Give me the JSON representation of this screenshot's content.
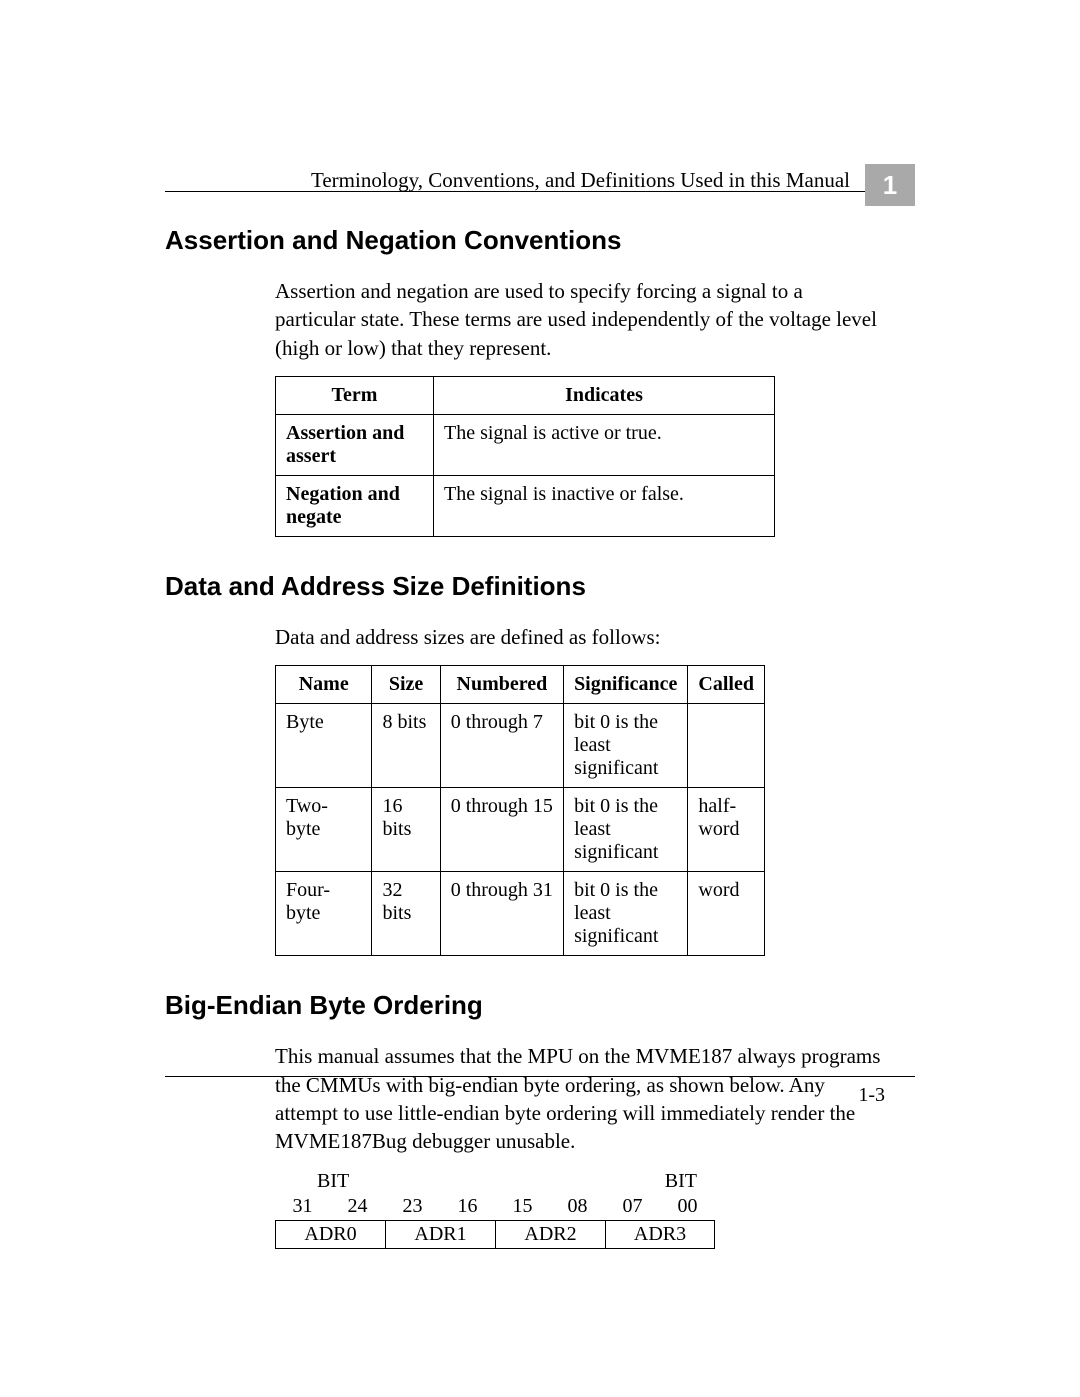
{
  "header": {
    "running_title": "Terminology, Conventions, and Definitions Used in this Manual",
    "chapter_number": "1"
  },
  "sections": {
    "s1": {
      "heading": "Assertion and Negation Conventions",
      "para": "Assertion and negation are used to specify forcing a signal to a particular state. These terms are used independently of the voltage level (high or low) that they represent.",
      "table": {
        "headers": {
          "term": "Term",
          "indicates": "Indicates"
        },
        "rows": [
          {
            "term": "Assertion and assert",
            "indicates": "The signal is active or true."
          },
          {
            "term": "Negation and negate",
            "indicates": "The signal is inactive or false."
          }
        ]
      }
    },
    "s2": {
      "heading": "Data and Address Size Definitions",
      "para": "Data and address sizes are defined as follows:",
      "table": {
        "headers": {
          "name": "Name",
          "size": "Size",
          "numbered": "Numbered",
          "significance": "Significance",
          "called": "Called"
        },
        "rows": [
          {
            "name": "Byte",
            "size": "8 bits",
            "numbered": "0 through 7",
            "significance": "bit 0 is the least significant",
            "called": ""
          },
          {
            "name": "Two-byte",
            "size": "16 bits",
            "numbered": "0 through 15",
            "significance": "bit 0 is the least significant",
            "called": "half-word"
          },
          {
            "name": "Four-byte",
            "size": "32 bits",
            "numbered": "0 through 31",
            "significance": "bit 0 is the least significant",
            "called": "word"
          }
        ]
      }
    },
    "s3": {
      "heading": "Big-Endian Byte Ordering",
      "para": "This manual assumes that the MPU on the MVME187 always programs the CMMUs with big-endian byte ordering, as shown below. Any attempt to use little-endian byte ordering will immediately render the MVME187Bug debugger unusable.",
      "diagram": {
        "bit_label_left": "BIT",
        "bit_label_right": "BIT",
        "nums": [
          "31",
          "24",
          "23",
          "16",
          "15",
          "08",
          "07",
          "00"
        ],
        "cells": [
          "ADR0",
          "ADR1",
          "ADR2",
          "ADR3"
        ]
      }
    }
  },
  "footer": {
    "page_number": "1-3"
  }
}
